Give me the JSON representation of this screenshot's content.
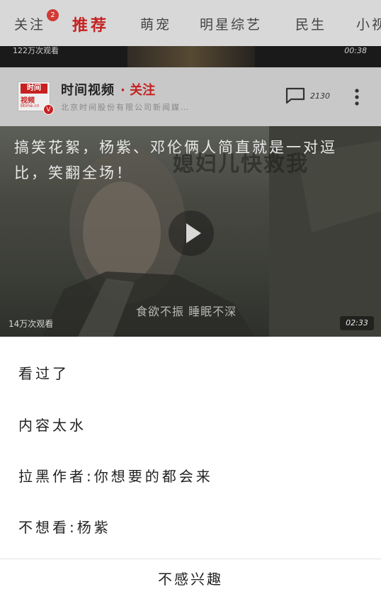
{
  "tabs": [
    {
      "label": "关注",
      "badge": "2"
    },
    {
      "label": "推荐",
      "active": true
    },
    {
      "label": "萌宠"
    },
    {
      "label": "明星综艺"
    },
    {
      "label": "民生"
    },
    {
      "label": "小视"
    }
  ],
  "previous_item": {
    "views": "122万次观看",
    "duration": "00:38"
  },
  "card": {
    "source_logo_text_top": "时间",
    "source_logo_text_bottom": "视频",
    "source_logo_url_text": "btime.cn",
    "source_logo_badge": "V",
    "source_name": "时间视频",
    "follow_label": "· 关注",
    "source_description": "北京时间股份有限公司新闻媒…",
    "comment_count": "2130",
    "video": {
      "title": "搞笑花絮，杨紫、邓伦俩人简直就是一对逗比，笑翻全场！",
      "watermark_text": "媳妇儿快救我",
      "subtitle_text": "食欲不振 睡眠不深",
      "views": "14万次观看",
      "duration": "02:33"
    }
  },
  "sheet": {
    "options": [
      {
        "label": "看过了"
      },
      {
        "label": "内容太水"
      },
      {
        "label": "拉黑作者:你想要的都会来"
      },
      {
        "label": "不想看:杨紫"
      }
    ],
    "action_label": "不感兴趣"
  },
  "colors": {
    "accent": "#c62121",
    "overlay": "#d8d8d8",
    "sheet_bg": "#ffffff"
  },
  "icons": {
    "comment": "comment-bubble-icon",
    "more": "more-vertical-icon",
    "play": "play-icon",
    "verified": "verified-badge-icon"
  }
}
